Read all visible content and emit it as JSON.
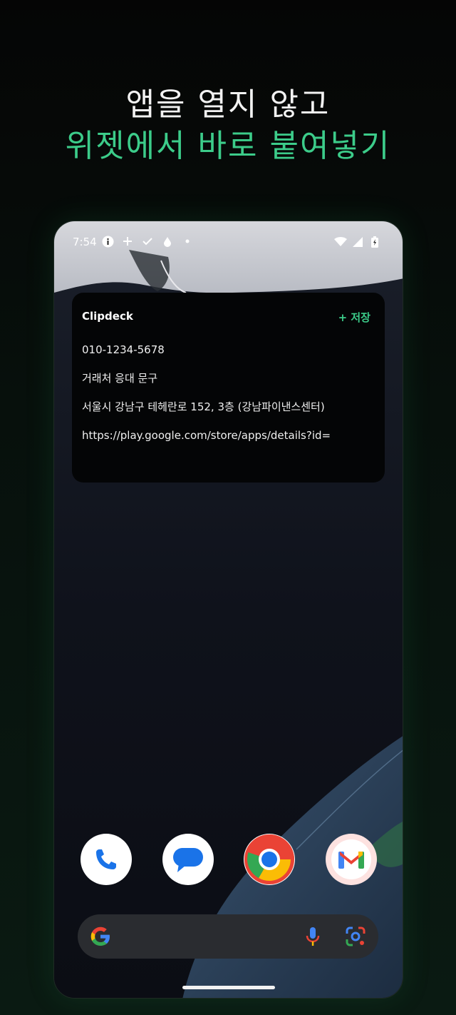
{
  "headline": {
    "line1": "앱을 열지 않고",
    "line2": "위젯에서 바로 붙여넣기"
  },
  "status_bar": {
    "time": "7:54",
    "left_icons": [
      "info-icon",
      "plus-icon",
      "check-icon",
      "drop-icon",
      "dot-icon"
    ],
    "right_icons": [
      "wifi-icon",
      "signal-icon",
      "battery-icon"
    ]
  },
  "widget": {
    "title": "Clipdeck",
    "save_label": "+ 저장",
    "clips": [
      "010-1234-5678",
      "거래처 응대 문구",
      "서울시 강남구 테헤란로 152, 3층 (강남파이낸스센터)",
      "https://play.google.com/store/apps/details?id="
    ]
  },
  "dock": {
    "apps": [
      "phone",
      "messages",
      "chrome",
      "gmail"
    ]
  },
  "colors": {
    "accent": "#3ccc8a",
    "widget_bg": "#040506",
    "search_bg": "#2a2c30"
  }
}
